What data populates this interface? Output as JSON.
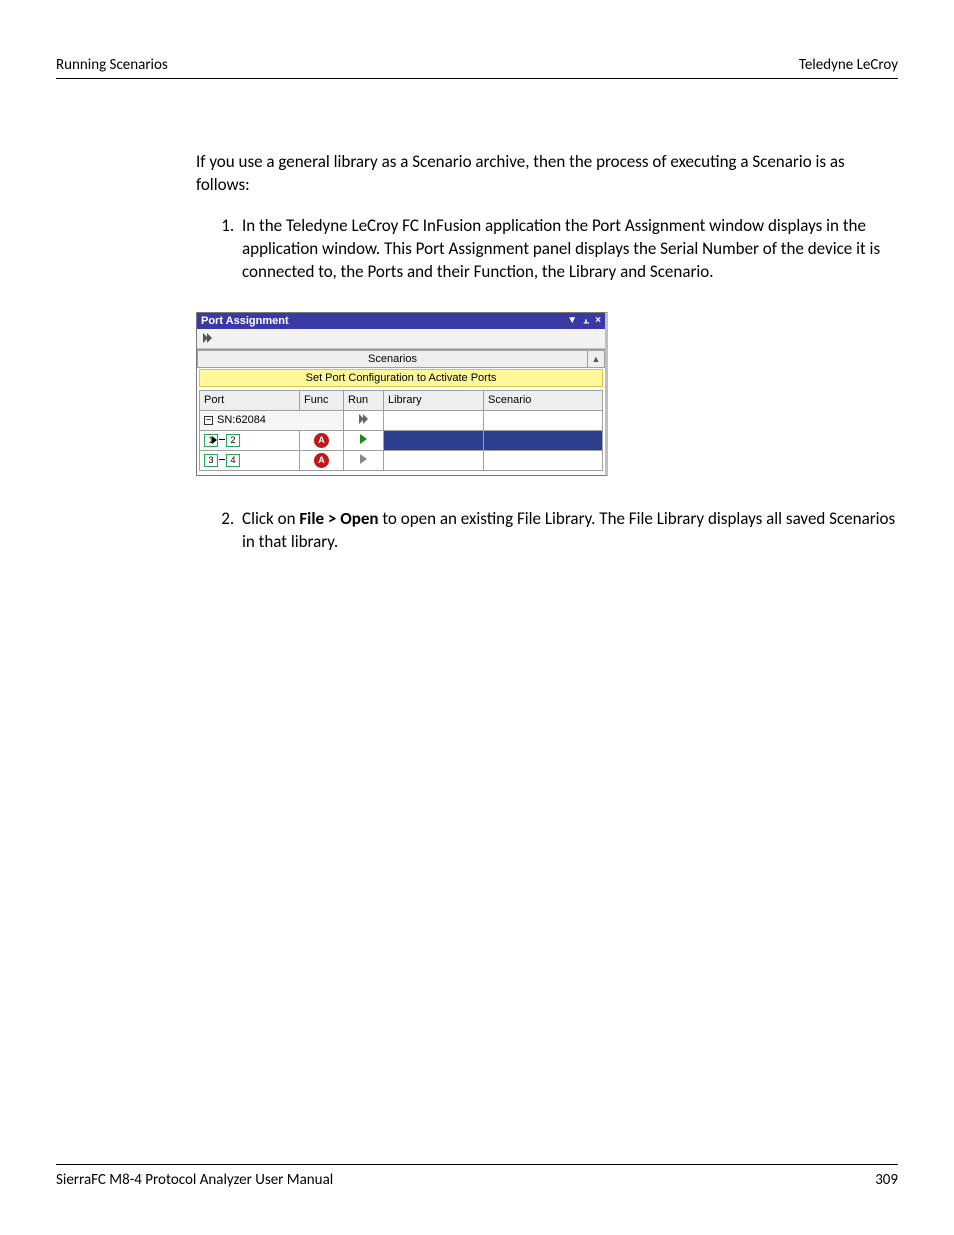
{
  "header": {
    "left": "Running Scenarios",
    "right": "Teledyne LeCroy"
  },
  "intro": "If you use a general library as a Scenario archive, then the process of executing a Scenario is as follows:",
  "steps": {
    "s1": "In the Teledyne LeCroy FC InFusion application the Port Assignment window displays in the application window. This Port Assignment panel displays the Serial Number of the device it is connected to, the Ports and their Function, the Library and Scenario.",
    "s2_pre": "Click on ",
    "s2_bold": "File > Open",
    "s2_post": " to open an existing File Library. The File Library displays all saved Scenarios in that library."
  },
  "panel": {
    "title": "Port Assignment",
    "scenarios_label": "Scenarios",
    "banner": "Set Port Configuration to Activate Ports",
    "cols": {
      "port": "Port",
      "func": "Func",
      "run": "Run",
      "library": "Library",
      "scenario": "Scenario"
    },
    "sn_label": "SN:62084",
    "row1": {
      "p1": "1",
      "p2": "2",
      "func": "A"
    },
    "row2": {
      "p1": "3",
      "p2": "4",
      "func": "A"
    }
  },
  "footer": {
    "left": "SierraFC M8-4 Protocol Analyzer User Manual",
    "right": "309"
  }
}
